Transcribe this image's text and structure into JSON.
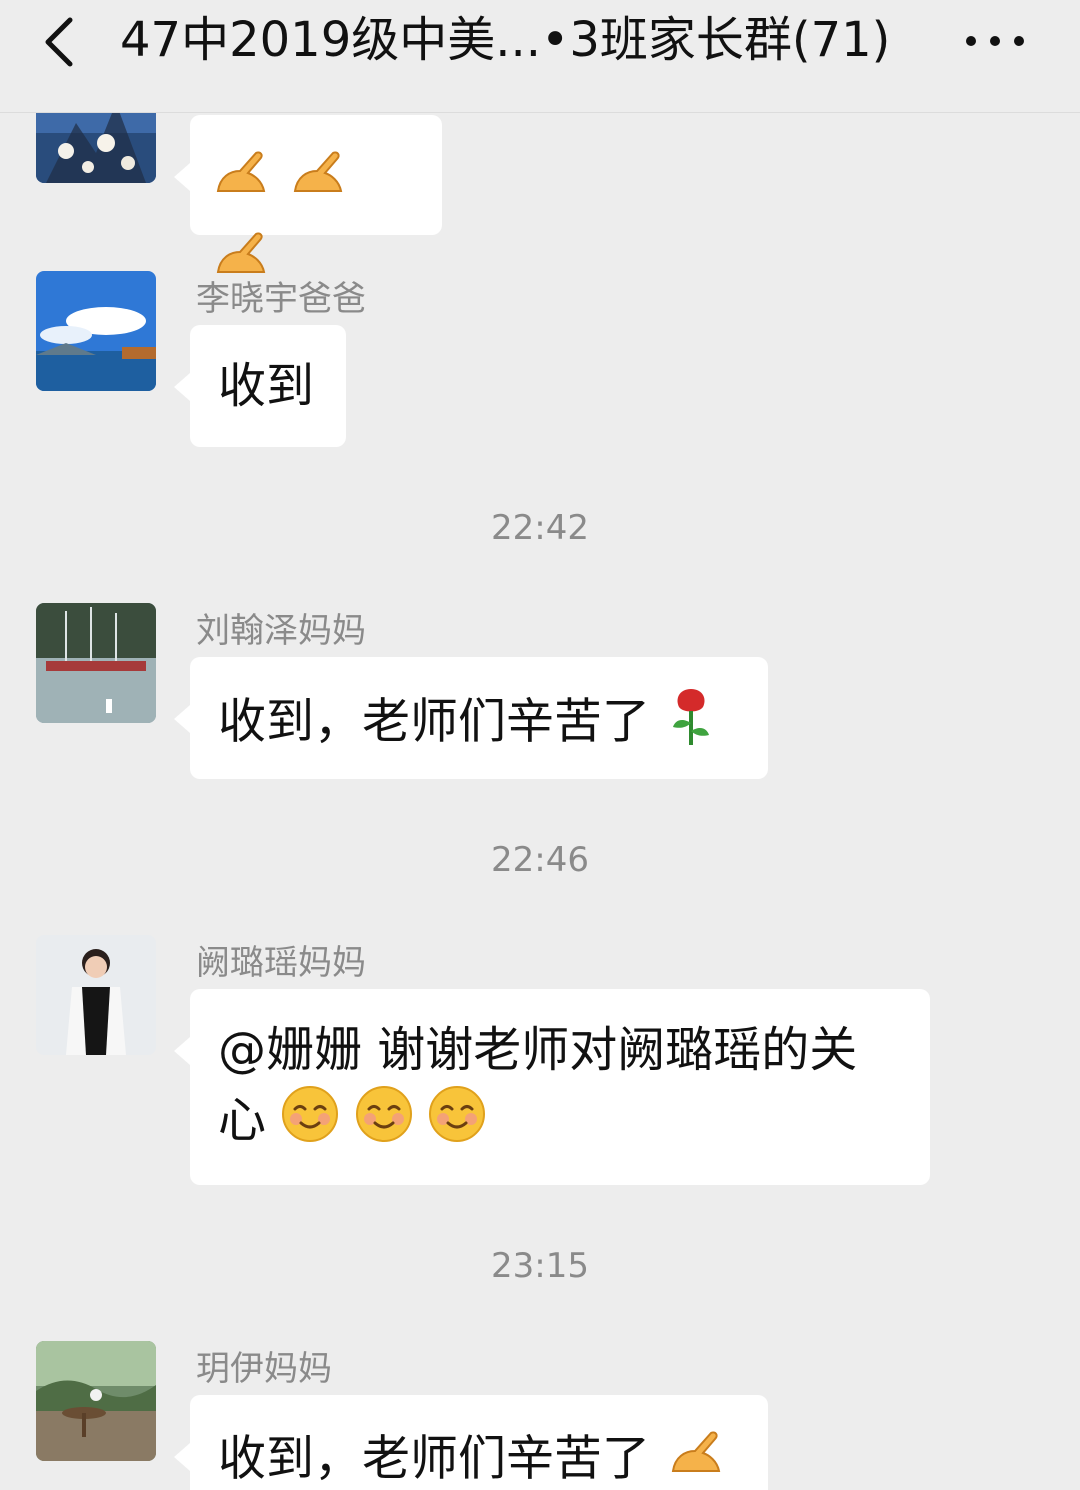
{
  "header": {
    "title": "47中2019级中美...•3班家长群(71)",
    "back_icon": "chevron-left-icon",
    "more_icon": "more-dots-icon"
  },
  "messages": [
    {
      "sender": "",
      "text": "",
      "emojis": [
        "ok-hand-icon",
        "ok-hand-icon",
        "ok-hand-icon"
      ]
    },
    {
      "sender": "李晓宇爸爸",
      "text": "收到"
    },
    {
      "time": "22:42"
    },
    {
      "sender": "刘翰泽妈妈",
      "text": "收到，老师们辛苦了",
      "emojis": [
        "rose-icon"
      ]
    },
    {
      "time": "22:46"
    },
    {
      "sender": "阙璐瑶妈妈",
      "text": "@姗姗  谢谢老师对阙璐瑶的关心",
      "emojis": [
        "smiling-face-icon",
        "smiling-face-icon",
        "smiling-face-icon"
      ]
    },
    {
      "time": "23:15"
    },
    {
      "sender": "玥伊妈妈",
      "text": "收到，老师们辛苦了",
      "emojis": [
        "ok-hand-icon"
      ]
    }
  ],
  "colors": {
    "background": "#ededed",
    "bubble": "#ffffff",
    "meta_text": "#8a8a8a",
    "primary_text": "#111111"
  }
}
